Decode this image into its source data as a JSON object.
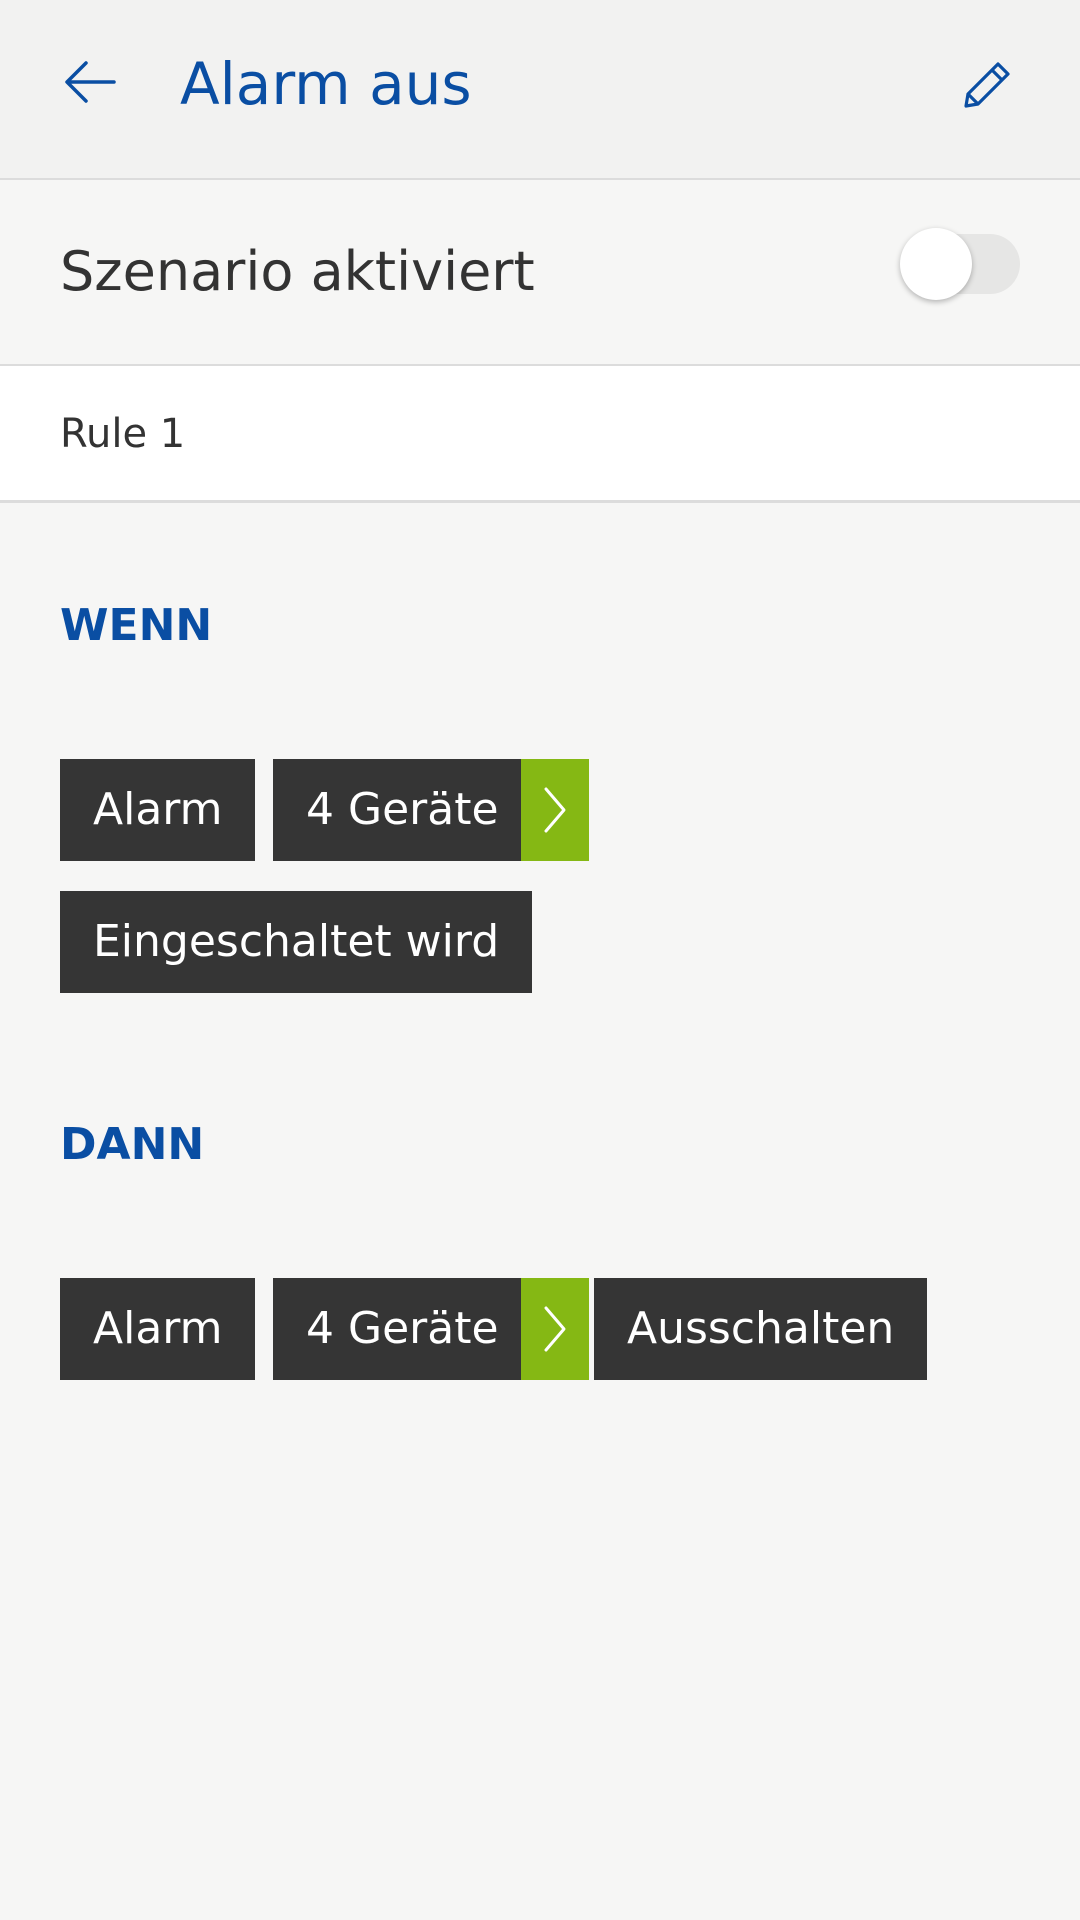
{
  "header": {
    "title": "Alarm aus",
    "back_icon": "arrow-left-icon",
    "edit_icon": "pencil-icon",
    "accent_color": "#0a4ea3"
  },
  "scenario": {
    "label": "Szenario aktiviert",
    "enabled": false
  },
  "rule": {
    "name": "Rule 1"
  },
  "when": {
    "heading": "WENN",
    "device_type": "Alarm",
    "devices": "4 Geräte",
    "condition": "Eingeschaltet wird"
  },
  "then": {
    "heading": "DANN",
    "device_type": "Alarm",
    "devices": "4 Geräte",
    "action": "Ausschalten"
  },
  "colors": {
    "chip_bg": "#353535",
    "chip_arrow_bg": "#85b814"
  }
}
